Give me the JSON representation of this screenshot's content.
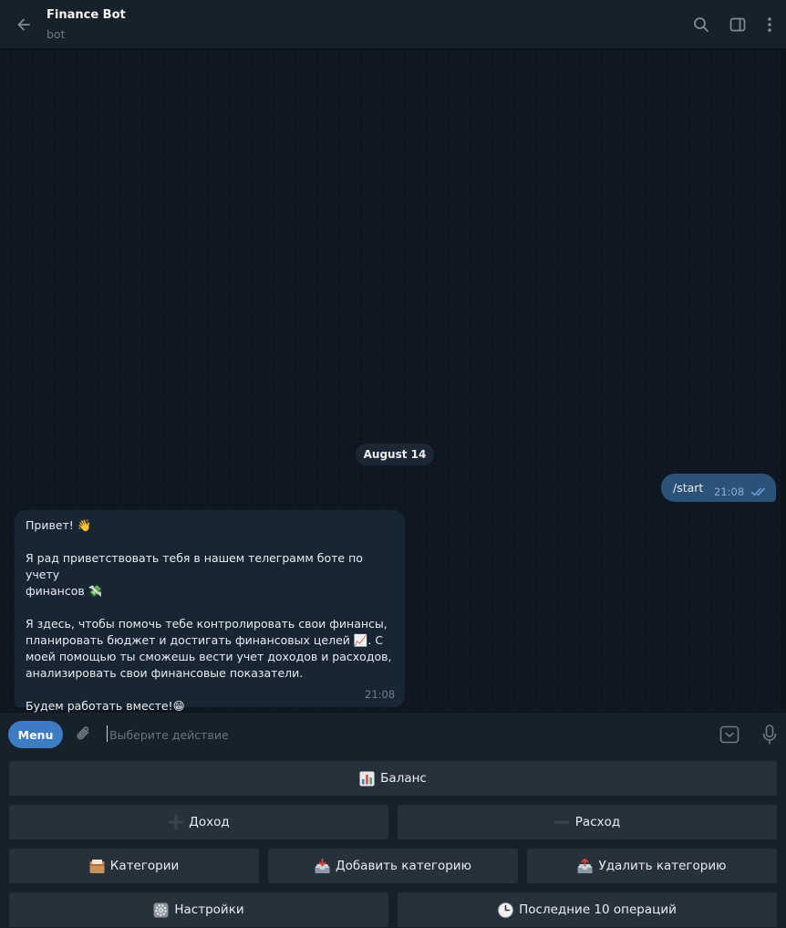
{
  "header": {
    "title": "Finance Bot",
    "subtitle": "bot",
    "icons": [
      "back-arrow-icon",
      "search-icon",
      "sidebar-toggle-icon",
      "more-vertical-icon"
    ]
  },
  "chat": {
    "date_label": "August 14",
    "outgoing": {
      "text": "/start",
      "time": "21:08",
      "status": "read"
    },
    "incoming": {
      "lines": [
        "Привет! 👋",
        "",
        "Я рад приветствовать тебя в нашем телеграмм боте по учету",
        "финансов 💸",
        "",
        "Я здесь, чтобы помочь тебе контролировать свои финансы,",
        "планировать бюджет и достигать финансовых целей 📈. С",
        "моей помощью ты сможешь вести учет доходов и расходов,",
        "анализировать свои финансовые показатели.",
        "",
        "Будем работать вместе!😁"
      ],
      "time": "21:08"
    }
  },
  "input": {
    "menu_label": "Menu",
    "placeholder": "Выберите действие",
    "value": ""
  },
  "keyboard": {
    "balance": {
      "label": "Баланс",
      "icon": "bar-chart-icon"
    },
    "income": {
      "label": "Доход",
      "icon": "plus-icon"
    },
    "expense": {
      "label": "Расход",
      "icon": "minus-icon"
    },
    "categories": {
      "label": "Категории",
      "icon": "card-box-icon"
    },
    "add_category": {
      "label": "Добавить категорию",
      "icon": "inbox-tray-icon"
    },
    "delete_category": {
      "label": "Удалить категорию",
      "icon": "outbox-tray-icon"
    },
    "settings": {
      "label": "Настройки",
      "icon": "gear-icon"
    },
    "last_ops": {
      "label": "Последние 10 операций",
      "icon": "clock-icon"
    }
  },
  "colors": {
    "background": "#0e1621",
    "panel": "#17212b",
    "outgoing_bubble": "#2b5278",
    "incoming_bubble": "#182533",
    "accent": "#3d7cc2",
    "keyboard_button": "#26313c"
  }
}
